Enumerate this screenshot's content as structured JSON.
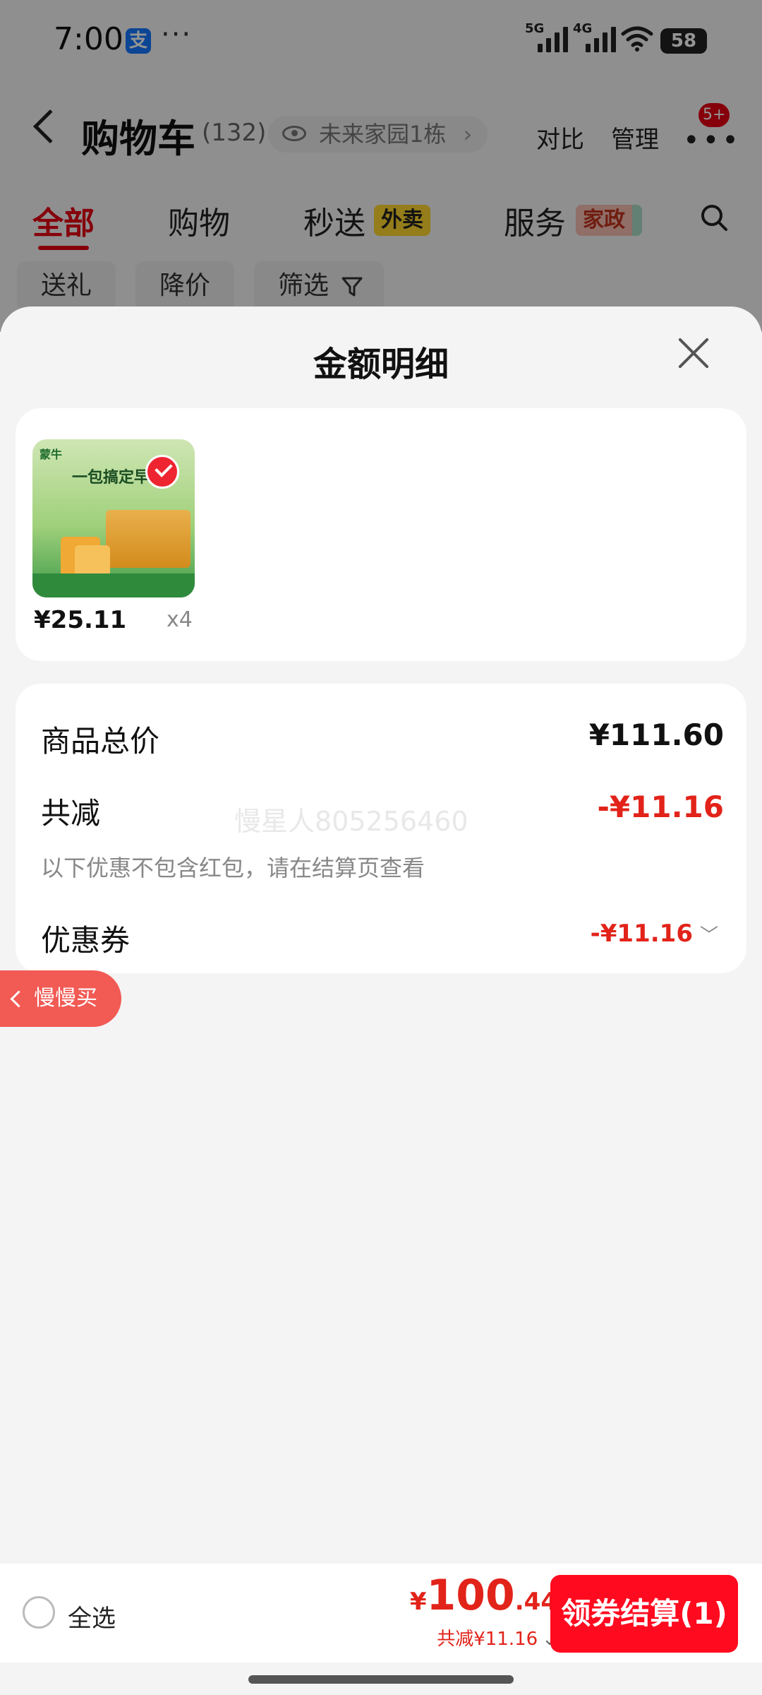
{
  "status_bar": {
    "time": "7:00",
    "app_icon": "支",
    "more_dots": "···",
    "net1": "5G",
    "net2": "4G",
    "battery": "58"
  },
  "header": {
    "title": "购物车",
    "count": "(132)",
    "address": "未来家园1栋",
    "address_chevron": "›",
    "compare": "对比",
    "manage": "管理",
    "more": "•••",
    "notif_badge": "5+"
  },
  "tabs": {
    "all": "全部",
    "shopping": "购物",
    "instant": "秒送",
    "instant_tag": "外卖",
    "service": "服务",
    "service_tag": "家政"
  },
  "filters": {
    "gift": "送礼",
    "price_drop": "降价",
    "filter": "筛选"
  },
  "sheet": {
    "title": "金额明细",
    "product": {
      "image_headline": "一包搞定早餐",
      "brand": "蒙牛",
      "unit_price": "¥25.11",
      "qty": "x4"
    },
    "summary": {
      "total_label": "商品总价",
      "total_value": "¥111.60",
      "discount_label": "共减",
      "discount_value": "-¥11.16",
      "note": "以下优惠不包含红包，请在结算页查看",
      "watermark": "慢星人805256460",
      "coupon_label": "优惠券",
      "coupon_value": "-¥11.16",
      "coupon_chevron": "﹀"
    },
    "slow_buy": "慢慢买"
  },
  "bottom_bar": {
    "select_all": "全选",
    "currency": "¥",
    "total_int": "100",
    "total_dec": ".44",
    "saved": "共减¥11.16",
    "saved_chevron": "⌄",
    "checkout": "领券结算(1)"
  },
  "colors": {
    "brand_red": "#e60012",
    "price_red": "#e2231a",
    "checkout_red": "#ff0a1f"
  }
}
